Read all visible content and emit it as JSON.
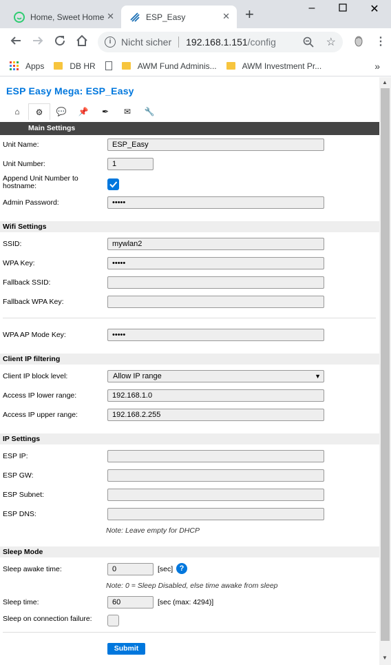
{
  "browser": {
    "tabs": [
      {
        "title": "Home, Sweet Home",
        "close": "✕"
      },
      {
        "title": "ESP_Easy",
        "close": "✕"
      }
    ],
    "new_tab": "+",
    "security_label": "Nicht sicher",
    "url_host": "192.168.1.151",
    "url_path": "/config",
    "bookmarks": [
      "Apps",
      "DB HR",
      "AWM Fund Adminis...",
      "AWM Investment Pr..."
    ],
    "bookmarks_more": "»"
  },
  "page": {
    "title": "ESP Easy Mega: ESP_Easy",
    "menu": [
      "⌂",
      "⚙",
      "💬",
      "📌",
      "✒",
      "✉",
      "🔧"
    ],
    "main_settings": "Main Settings",
    "unit_name_label": "Unit Name:",
    "unit_name_value": "ESP_Easy",
    "unit_number_label": "Unit Number:",
    "unit_number_value": "1",
    "append_label": "Append Unit Number to hostname:",
    "append_checked": true,
    "admin_password_label": "Admin Password:",
    "admin_password_value": "•••••",
    "wifi_section": "Wifi Settings",
    "ssid_label": "SSID:",
    "ssid_value": "mywlan2",
    "wpa_key_label": "WPA Key:",
    "wpa_key_value": "•••••",
    "fallback_ssid_label": "Fallback SSID:",
    "fallback_ssid_value": "",
    "fallback_wpa_label": "Fallback WPA Key:",
    "fallback_wpa_value": "",
    "wpa_ap_label": "WPA AP Mode Key:",
    "wpa_ap_value": "•••••",
    "client_ip_section": "Client IP filtering",
    "block_level_label": "Client IP block level:",
    "block_level_value": "Allow IP range",
    "lower_range_label": "Access IP lower range:",
    "lower_range_value": "192.168.1.0",
    "upper_range_label": "Access IP upper range:",
    "upper_range_value": "192.168.2.255",
    "ip_section": "IP Settings",
    "esp_ip_label": "ESP IP:",
    "esp_gw_label": "ESP GW:",
    "esp_subnet_label": "ESP Subnet:",
    "esp_dns_label": "ESP DNS:",
    "dhcp_note": "Note: Leave empty for DHCP",
    "sleep_section": "Sleep Mode",
    "sleep_awake_label": "Sleep awake time:",
    "sleep_awake_value": "0",
    "sec_unit": "[sec]",
    "help_icon": "?",
    "sleep_note": "Note: 0 = Sleep Disabled, else time awake from sleep",
    "sleep_time_label": "Sleep time:",
    "sleep_time_value": "60",
    "sleep_time_unit": "[sec (max: 4294)]",
    "sleep_fail_label": "Sleep on connection failure:",
    "sleep_fail_checked": false,
    "submit_label": "Submit"
  },
  "colors": {
    "accent": "#0077dd",
    "header_bar": "#444444",
    "section_bg": "#eeeeee"
  }
}
